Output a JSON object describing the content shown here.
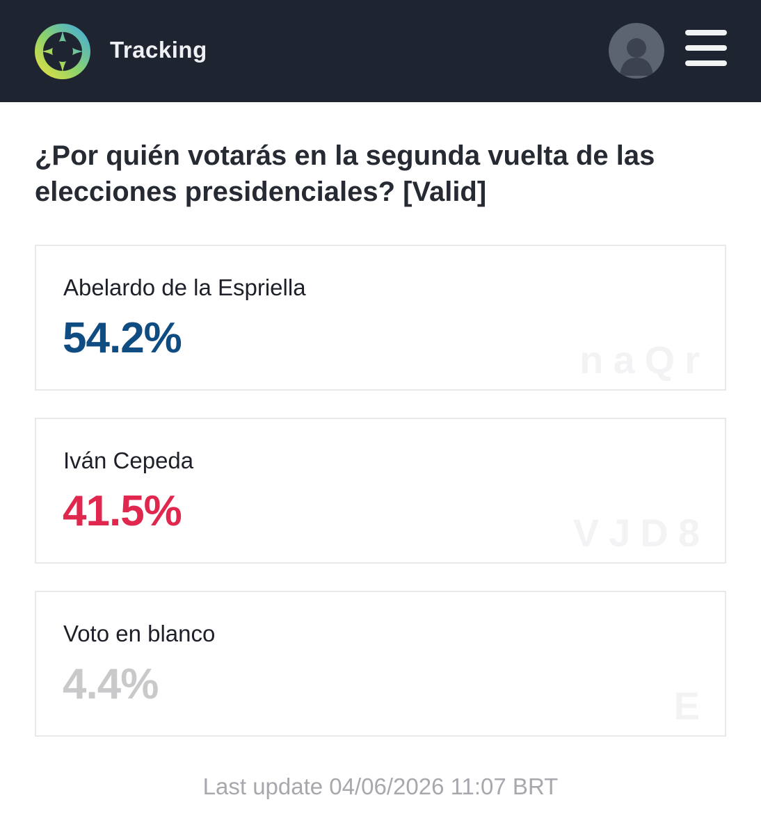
{
  "header": {
    "brand": "Tracking",
    "background": "#1f2530"
  },
  "question": "¿Por quién votarás en la segunda vuelta de las elecciones presidenciales? [Valid]",
  "results": [
    {
      "name": "Abelardo de la Espriella",
      "percent": "54.2%",
      "color": "#0f4c81"
    },
    {
      "name": "Iván Cepeda",
      "percent": "41.5%",
      "color": "#e0284f"
    },
    {
      "name": "Voto en blanco",
      "percent": "4.4%",
      "color": "#c9c9cc"
    }
  ],
  "footer": {
    "last_update": "Last update 04/06/2026 11:07 BRT"
  },
  "icons": {
    "logo": "compass-logo-icon",
    "avatar": "user-avatar-icon",
    "menu": "hamburger-menu-icon"
  }
}
